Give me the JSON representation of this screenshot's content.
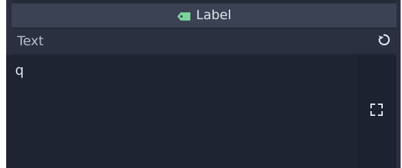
{
  "header": {
    "title": "Label",
    "icon": "tag-icon",
    "icon_color": "#7cd39a"
  },
  "property": {
    "label": "Text",
    "revert_icon": "revert-icon"
  },
  "editor": {
    "value": "q",
    "expand_icon": "expand-icon"
  },
  "colors": {
    "panel": "#252b39",
    "header": "#3b4253",
    "text": "#dfe3ea"
  }
}
